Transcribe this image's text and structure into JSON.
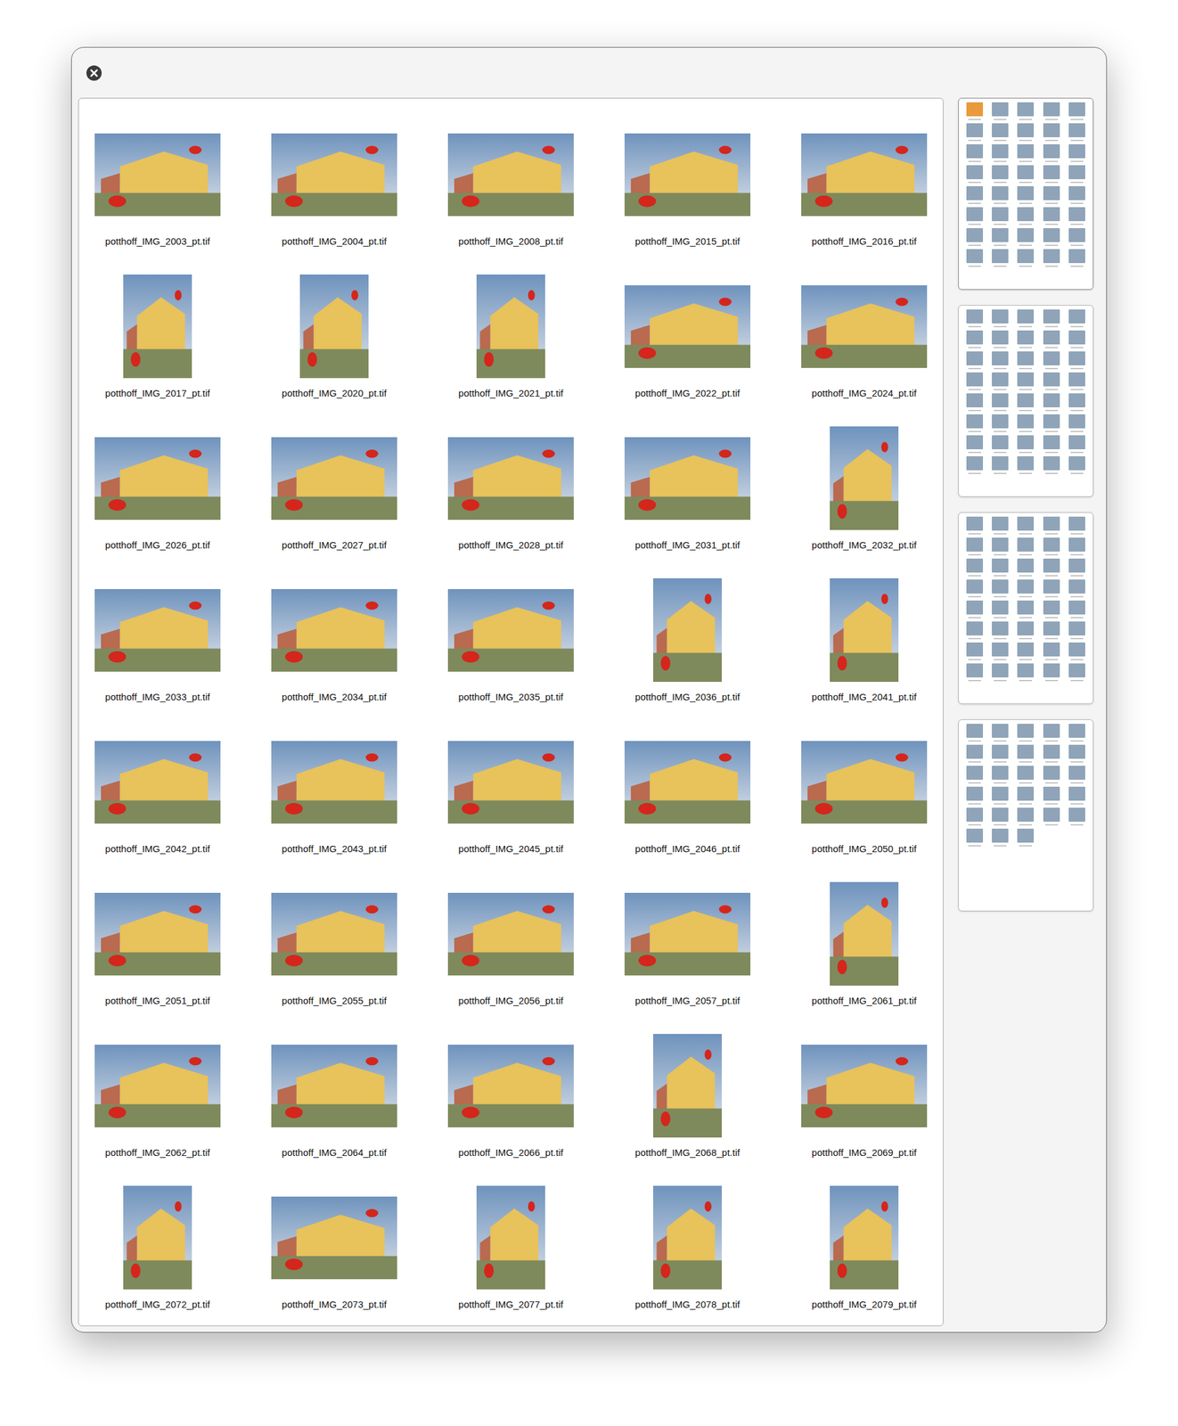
{
  "viewer": {
    "close_button": {
      "label": ""
    }
  },
  "thumbnails": [
    {
      "label": "potthoff_IMG_2003_pt.tif",
      "kind": "landscape"
    },
    {
      "label": "potthoff_IMG_2004_pt.tif",
      "kind": "landscape"
    },
    {
      "label": "potthoff_IMG_2008_pt.tif",
      "kind": "landscape"
    },
    {
      "label": "potthoff_IMG_2015_pt.tif",
      "kind": "landscape"
    },
    {
      "label": "potthoff_IMG_2016_pt.tif",
      "kind": "landscape"
    },
    {
      "label": "potthoff_IMG_2017_pt.tif",
      "kind": "portrait"
    },
    {
      "label": "potthoff_IMG_2020_pt.tif",
      "kind": "portrait"
    },
    {
      "label": "potthoff_IMG_2021_pt.tif",
      "kind": "portrait"
    },
    {
      "label": "potthoff_IMG_2022_pt.tif",
      "kind": "landscape"
    },
    {
      "label": "potthoff_IMG_2024_pt.tif",
      "kind": "landscape"
    },
    {
      "label": "potthoff_IMG_2026_pt.tif",
      "kind": "landscape"
    },
    {
      "label": "potthoff_IMG_2027_pt.tif",
      "kind": "landscape"
    },
    {
      "label": "potthoff_IMG_2028_pt.tif",
      "kind": "landscape"
    },
    {
      "label": "potthoff_IMG_2031_pt.tif",
      "kind": "landscape"
    },
    {
      "label": "potthoff_IMG_2032_pt.tif",
      "kind": "portrait"
    },
    {
      "label": "potthoff_IMG_2033_pt.tif",
      "kind": "landscape"
    },
    {
      "label": "potthoff_IMG_2034_pt.tif",
      "kind": "landscape"
    },
    {
      "label": "potthoff_IMG_2035_pt.tif",
      "kind": "landscape"
    },
    {
      "label": "potthoff_IMG_2036_pt.tif",
      "kind": "portrait"
    },
    {
      "label": "potthoff_IMG_2041_pt.tif",
      "kind": "portrait"
    },
    {
      "label": "potthoff_IMG_2042_pt.tif",
      "kind": "landscape"
    },
    {
      "label": "potthoff_IMG_2043_pt.tif",
      "kind": "landscape"
    },
    {
      "label": "potthoff_IMG_2045_pt.tif",
      "kind": "landscape"
    },
    {
      "label": "potthoff_IMG_2046_pt.tif",
      "kind": "landscape"
    },
    {
      "label": "potthoff_IMG_2050_pt.tif",
      "kind": "landscape"
    },
    {
      "label": "potthoff_IMG_2051_pt.tif",
      "kind": "landscape"
    },
    {
      "label": "potthoff_IMG_2055_pt.tif",
      "kind": "landscape"
    },
    {
      "label": "potthoff_IMG_2056_pt.tif",
      "kind": "landscape"
    },
    {
      "label": "potthoff_IMG_2057_pt.tif",
      "kind": "landscape"
    },
    {
      "label": "potthoff_IMG_2061_pt.tif",
      "kind": "portrait"
    },
    {
      "label": "potthoff_IMG_2062_pt.tif",
      "kind": "landscape"
    },
    {
      "label": "potthoff_IMG_2064_pt.tif",
      "kind": "landscape"
    },
    {
      "label": "potthoff_IMG_2066_pt.tif",
      "kind": "landscape"
    },
    {
      "label": "potthoff_IMG_2068_pt.tif",
      "kind": "portrait"
    },
    {
      "label": "potthoff_IMG_2069_pt.tif",
      "kind": "landscape"
    },
    {
      "label": "potthoff_IMG_2072_pt.tif",
      "kind": "portrait"
    },
    {
      "label": "potthoff_IMG_2073_pt.tif",
      "kind": "landscape"
    },
    {
      "label": "potthoff_IMG_2077_pt.tif",
      "kind": "portrait"
    },
    {
      "label": "potthoff_IMG_2078_pt.tif",
      "kind": "portrait"
    },
    {
      "label": "potthoff_IMG_2079_pt.tif",
      "kind": "portrait"
    }
  ],
  "pages": [
    {
      "selected": true,
      "thumbs": 40
    },
    {
      "selected": false,
      "thumbs": 40
    },
    {
      "selected": false,
      "thumbs": 40
    },
    {
      "selected": false,
      "thumbs": 28
    }
  ]
}
